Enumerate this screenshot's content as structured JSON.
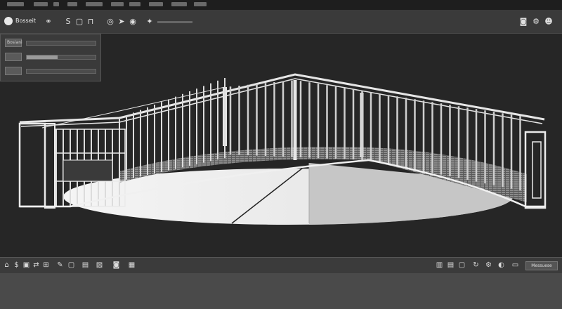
{
  "app": {
    "title": "Bosseit"
  },
  "colors": {
    "background": "#2a2a2a",
    "toolbar": "#3a3a3a",
    "viewport": "#262626",
    "model_stroke": "#e6e6e6",
    "floor_light": "#f2f2f2",
    "floor_shade": "#c8c8c8"
  },
  "menubar": {
    "items": [
      "",
      "",
      "",
      "",
      "",
      "",
      "",
      "",
      "",
      ""
    ]
  },
  "toolbar": {
    "left_icons": [
      "link-icon",
      "s-tool-icon",
      "select-icon",
      "magnet-icon",
      "view-icon",
      "cursor-icon",
      "pin-icon",
      "lightbulb-icon"
    ],
    "right_icons": [
      "camera-icon",
      "settings-icon",
      "user-icon"
    ]
  },
  "panel": {
    "rows": [
      {
        "label": "Bosiani",
        "slider": 0.0
      },
      {
        "label": "",
        "slider": 0.45
      },
      {
        "label": "",
        "slider": 0.0
      }
    ]
  },
  "statusbar": {
    "left_icons": [
      "home-icon",
      "dollar-icon",
      "save-icon",
      "share-icon",
      "grid-icon",
      "tool-icon",
      "frame-icon",
      "layers-icon",
      "image-icon",
      "camera-icon",
      "measure-icon"
    ],
    "right_icons": [
      "file-icon",
      "print-icon",
      "export-icon",
      "refresh-icon",
      "settings-icon",
      "help-icon"
    ],
    "field": "Messuese"
  }
}
